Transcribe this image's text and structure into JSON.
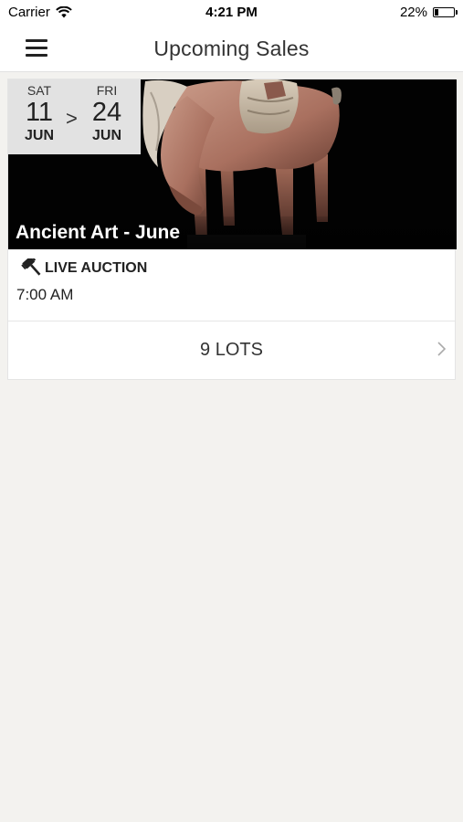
{
  "status_bar": {
    "carrier": "Carrier",
    "time": "4:21 PM",
    "battery_percent": "22%",
    "battery_level": 0.22
  },
  "nav": {
    "title": "Upcoming Sales",
    "menu_icon": "hamburger-menu-icon"
  },
  "sale": {
    "title": "Ancient Art - June",
    "start": {
      "dow": "SAT",
      "day": "11",
      "month": "JUN"
    },
    "separator": ">",
    "end": {
      "dow": "FRI",
      "day": "24",
      "month": "JUN"
    },
    "auction_type": "LIVE AUCTION",
    "auction_icon": "gavel-icon",
    "time": "7:00 AM",
    "lots_label": "9 LOTS",
    "image": "terracotta-horse-sculpture"
  },
  "colors": {
    "background": "#f3f2ef",
    "card": "#ffffff",
    "image_bg": "#020202",
    "text": "#222222"
  }
}
